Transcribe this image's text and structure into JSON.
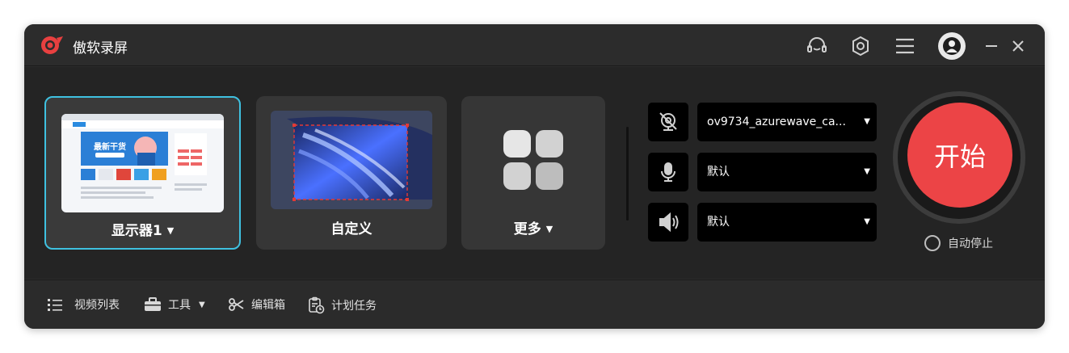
{
  "app": {
    "title": "傲软录屏"
  },
  "titlebar": {
    "icons": [
      "headset-icon",
      "settings-icon",
      "menu-icon",
      "avatar",
      "minimize-icon",
      "close-icon"
    ]
  },
  "capture_modes": [
    {
      "label": "显示器1",
      "caret": "▼",
      "selected": true
    },
    {
      "label": "自定义",
      "caret": ""
    },
    {
      "label": "更多",
      "caret": "▼"
    }
  ],
  "thumbnail": {
    "banner_text": "最新干货"
  },
  "devices": {
    "camera": {
      "value": "ov9734_azurewave_ca...",
      "icon": "camera-off-icon"
    },
    "microphone": {
      "value": "默认",
      "icon": "microphone-icon"
    },
    "speaker": {
      "value": "默认",
      "icon": "speaker-icon"
    }
  },
  "start": {
    "label": "开始"
  },
  "auto_stop": {
    "label": "自动停止",
    "checked": false
  },
  "footer": {
    "items": [
      {
        "label": "视频列表",
        "icon": "list-icon"
      },
      {
        "label": "工具",
        "icon": "toolbox-icon",
        "caret": "▼"
      },
      {
        "label": "编辑箱",
        "icon": "scissors-icon"
      },
      {
        "label": "计划任务",
        "icon": "clipboard-clock-icon"
      }
    ]
  },
  "colors": {
    "accent": "#3fc1e0",
    "start": "#ec4446",
    "background": "#242424"
  }
}
